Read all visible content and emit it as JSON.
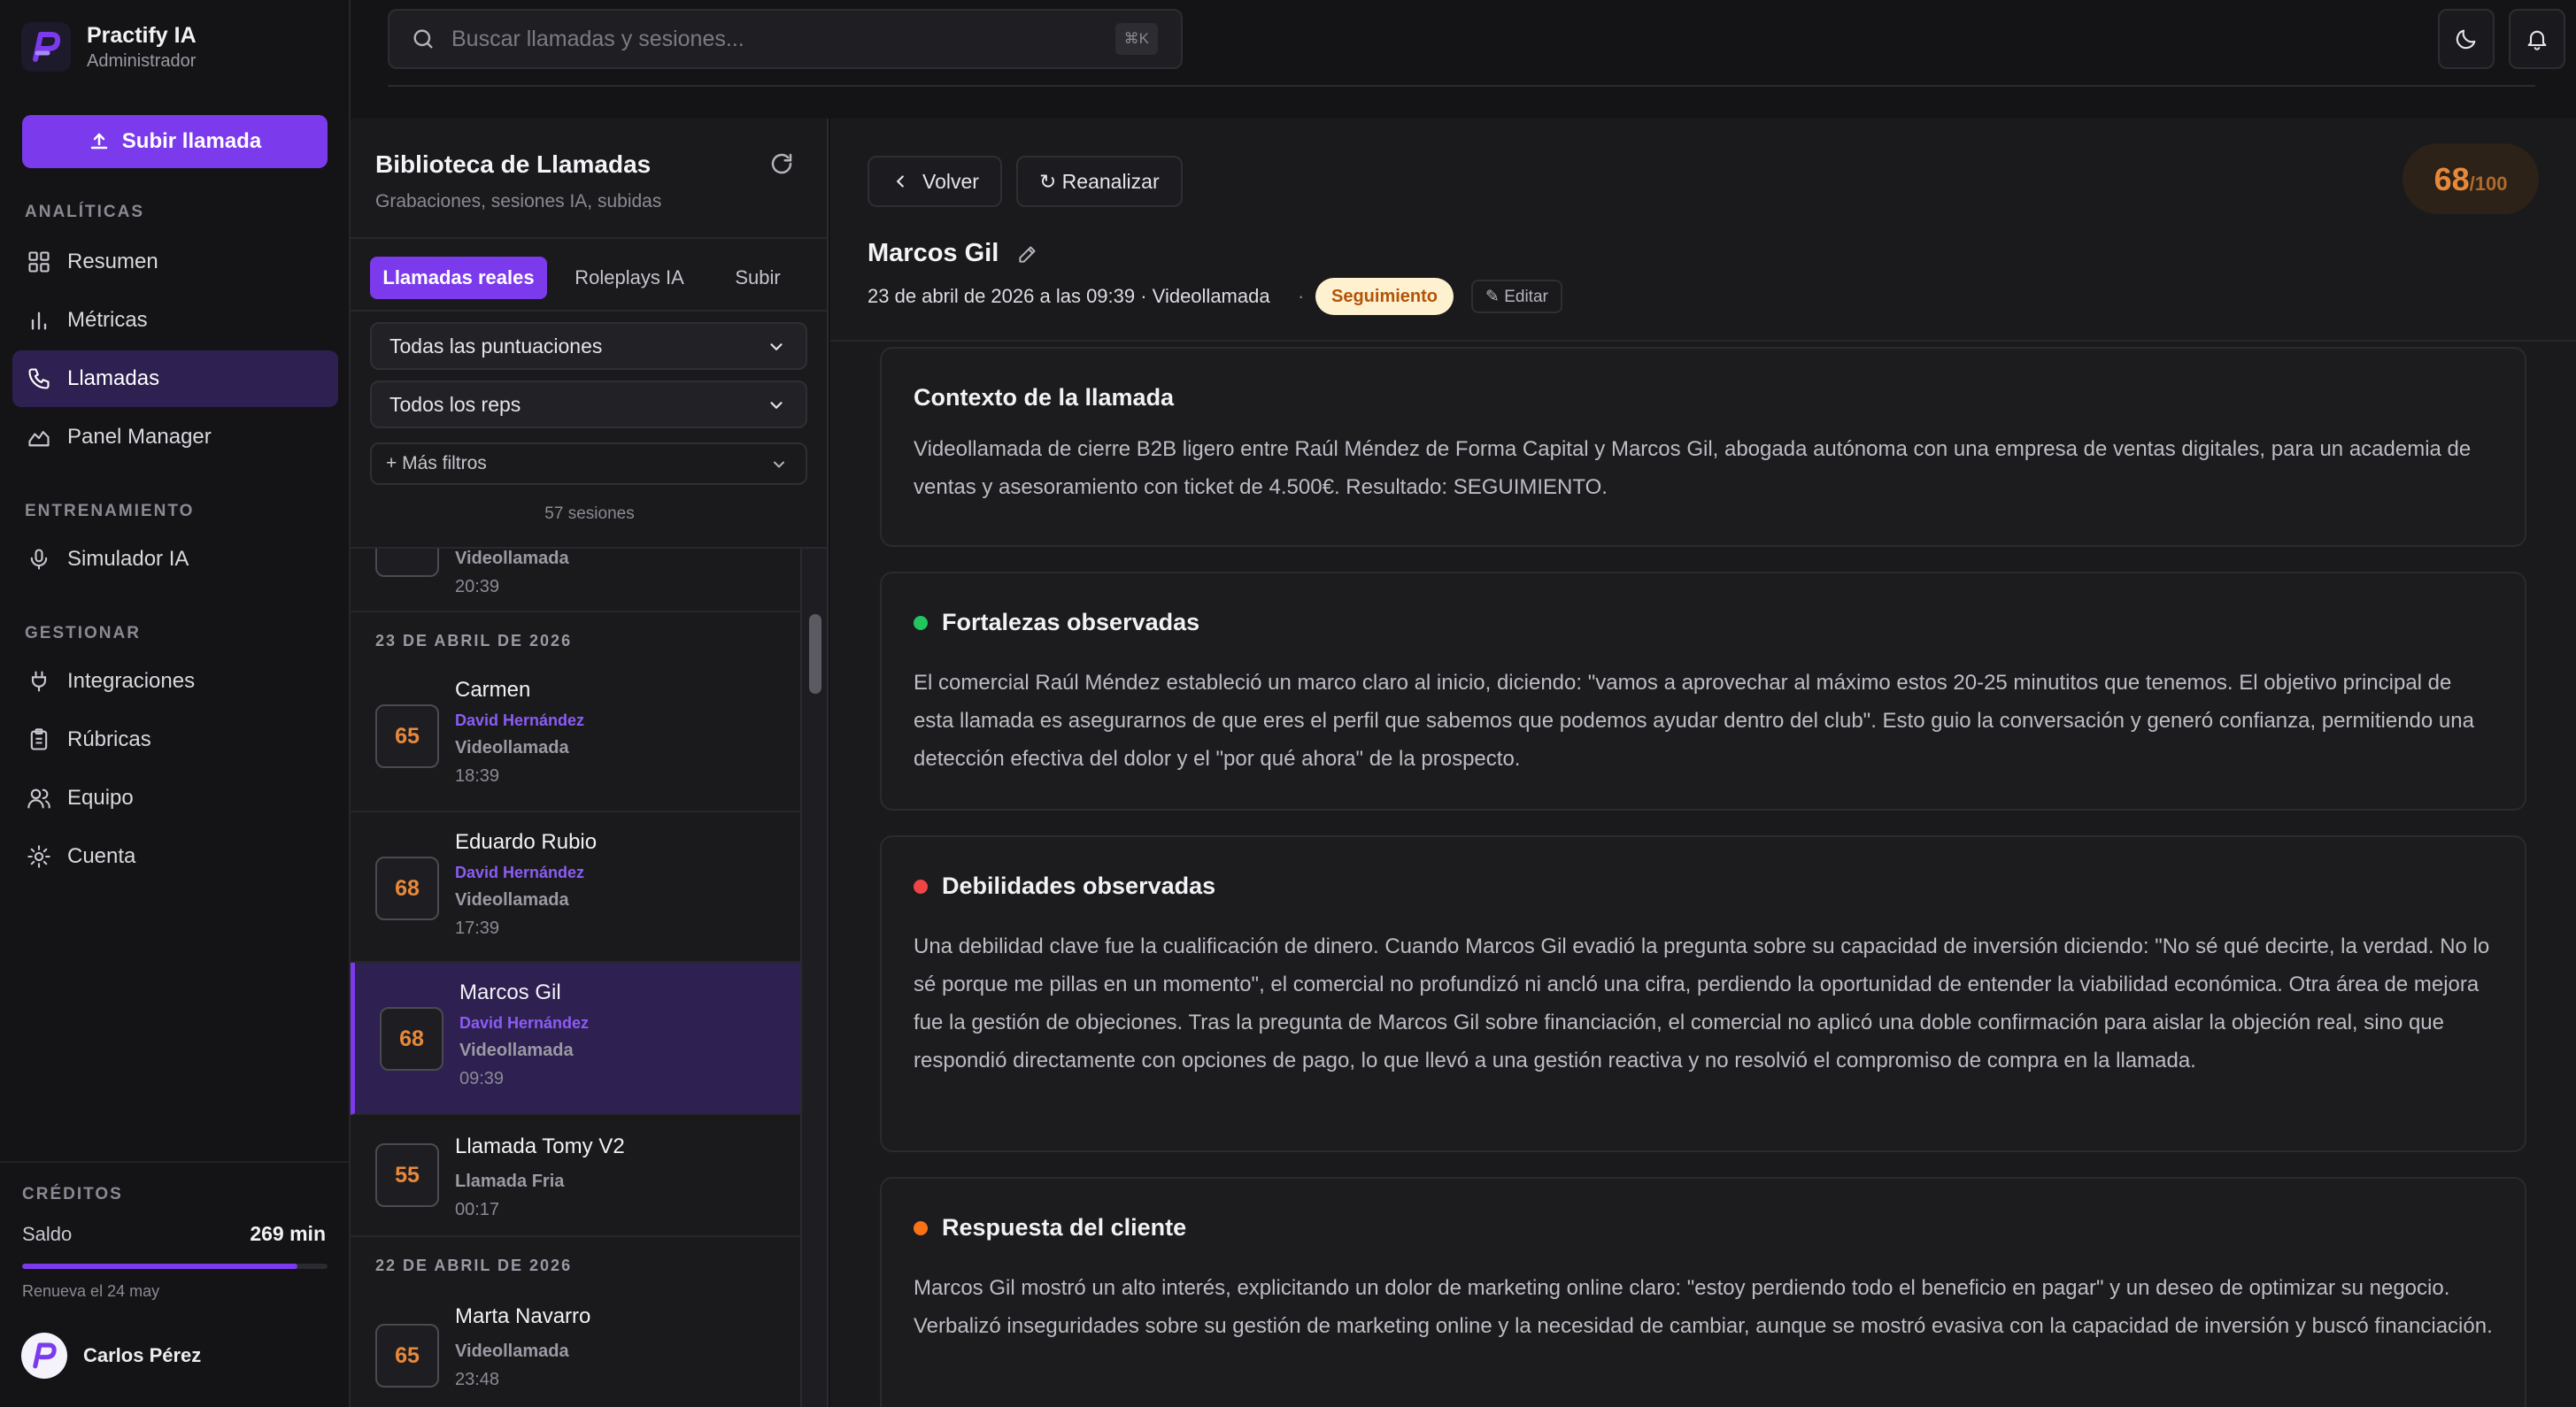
{
  "app": {
    "name": "Practify IA",
    "role": "Administrador"
  },
  "sidebar": {
    "upload_label": "Subir llamada",
    "sections": {
      "analytics": "ANALÍTICAS",
      "training": "ENTRENAMIENTO",
      "manage": "GESTIONAR"
    },
    "items": [
      {
        "label": "Resumen",
        "icon": "grid-icon"
      },
      {
        "label": "Métricas",
        "icon": "bar-chart-icon"
      },
      {
        "label": "Llamadas",
        "icon": "phone-icon",
        "active": true
      },
      {
        "label": "Panel Manager",
        "icon": "chart-line-icon"
      },
      {
        "label": "Simulador IA",
        "icon": "mic-icon"
      },
      {
        "label": "Integraciones",
        "icon": "plug-icon"
      },
      {
        "label": "Rúbricas",
        "icon": "clipboard-icon"
      },
      {
        "label": "Equipo",
        "icon": "users-icon"
      },
      {
        "label": "Cuenta",
        "icon": "settings-icon"
      }
    ],
    "credits": {
      "label": "CRÉDITOS",
      "saldo_label": "Saldo",
      "saldo_value": "269 min",
      "fill_fraction": 0.9,
      "renew": "Renueva el 24 may"
    },
    "user_name": "Carlos Pérez"
  },
  "topbar": {
    "search_placeholder": "Buscar llamadas y sesiones...",
    "shortcut": "⌘K"
  },
  "library": {
    "title": "Biblioteca de Llamadas",
    "subtitle": "Grabaciones, sesiones IA, subidas",
    "tabs": [
      "Llamadas reales",
      "Roleplays IA",
      "Subir"
    ],
    "filter_scores": "Todas las puntuaciones",
    "filter_reps": "Todos los reps",
    "more_filters": "+ Más filtros",
    "count": "57 sesiones",
    "partial_row": {
      "type": "Videollamada",
      "time": "20:39"
    },
    "groups": [
      {
        "date": "23 DE ABRIL DE 2026"
      },
      {
        "date": "22 DE ABRIL DE 2026"
      }
    ],
    "rows": [
      {
        "score": "65",
        "name": "Carmen",
        "rep": "David Hernández",
        "type": "Videollamada",
        "time": "18:39"
      },
      {
        "score": "68",
        "name": "Eduardo Rubio",
        "rep": "David Hernández",
        "type": "Videollamada",
        "time": "17:39"
      },
      {
        "score": "68",
        "name": "Marcos Gil",
        "rep": "David Hernández",
        "type": "Videollamada",
        "time": "09:39"
      },
      {
        "score": "55",
        "name": "Llamada Tomy V2",
        "rep": "",
        "type": "Llamada Fria",
        "time": "00:17"
      },
      {
        "score": "65",
        "name": "Marta Navarro",
        "rep": "",
        "type": "Videollamada",
        "time": "23:48"
      }
    ]
  },
  "detail": {
    "back_label": "Volver",
    "reanalyze_label": "↻ Reanalizar",
    "score": "68",
    "score_max": "/100",
    "name": "Marcos Gil",
    "meta": "23 de abril de 2026 a las 09:39 · Videollamada",
    "meta_sep": "·",
    "status": "Seguimiento",
    "edit_label": "✎ Editar",
    "cards": [
      {
        "title": "Contexto de la llamada",
        "body": "Videollamada de cierre B2B ligero entre Raúl Méndez de Forma Capital y Marcos Gil, abogada autónoma con una empresa de ventas digitales, para un academia de ventas y asesoramiento con ticket de 4.500€. Resultado: SEGUIMIENTO."
      },
      {
        "title": "Fortalezas observadas",
        "dot_color": "#22c55e",
        "body": "El comercial Raúl Méndez estableció un marco claro al inicio, diciendo: \"vamos a aprovechar al máximo estos 20-25 minutitos que tenemos. El objetivo principal de esta llamada es asegurarnos de que eres el perfil que sabemos que podemos ayudar dentro del club\". Esto guio la conversación y generó confianza, permitiendo una detección efectiva del dolor y el \"por qué ahora\" de la prospecto."
      },
      {
        "title": "Debilidades observadas",
        "dot_color": "#ef4444",
        "body": "Una debilidad clave fue la cualificación de dinero. Cuando Marcos Gil evadió la pregunta sobre su capacidad de inversión diciendo: \"No sé qué decirte, la verdad. No lo sé porque me pillas en un momento\", el comercial no profundizó ni ancló una cifra, perdiendo la oportunidad de entender la viabilidad económica. Otra área de mejora fue la gestión de objeciones. Tras la pregunta de Marcos Gil sobre financiación, el comercial no aplicó una doble confirmación para aislar la objeción real, sino que respondió directamente con opciones de pago, lo que llevó a una gestión reactiva y no resolvió el compromiso de compra en la llamada."
      },
      {
        "title": "Respuesta del cliente",
        "dot_color": "#f97316",
        "body": "Marcos Gil mostró un alto interés, explicitando un dolor de marketing online claro: \"estoy perdiendo todo el beneficio en pagar\" y un deseo de optimizar su negocio. Verbalizó inseguridades sobre su gestión de marketing online y la necesidad de cambiar, aunque se mostró evasiva con la capacidad de inversión y buscó financiación."
      }
    ]
  }
}
